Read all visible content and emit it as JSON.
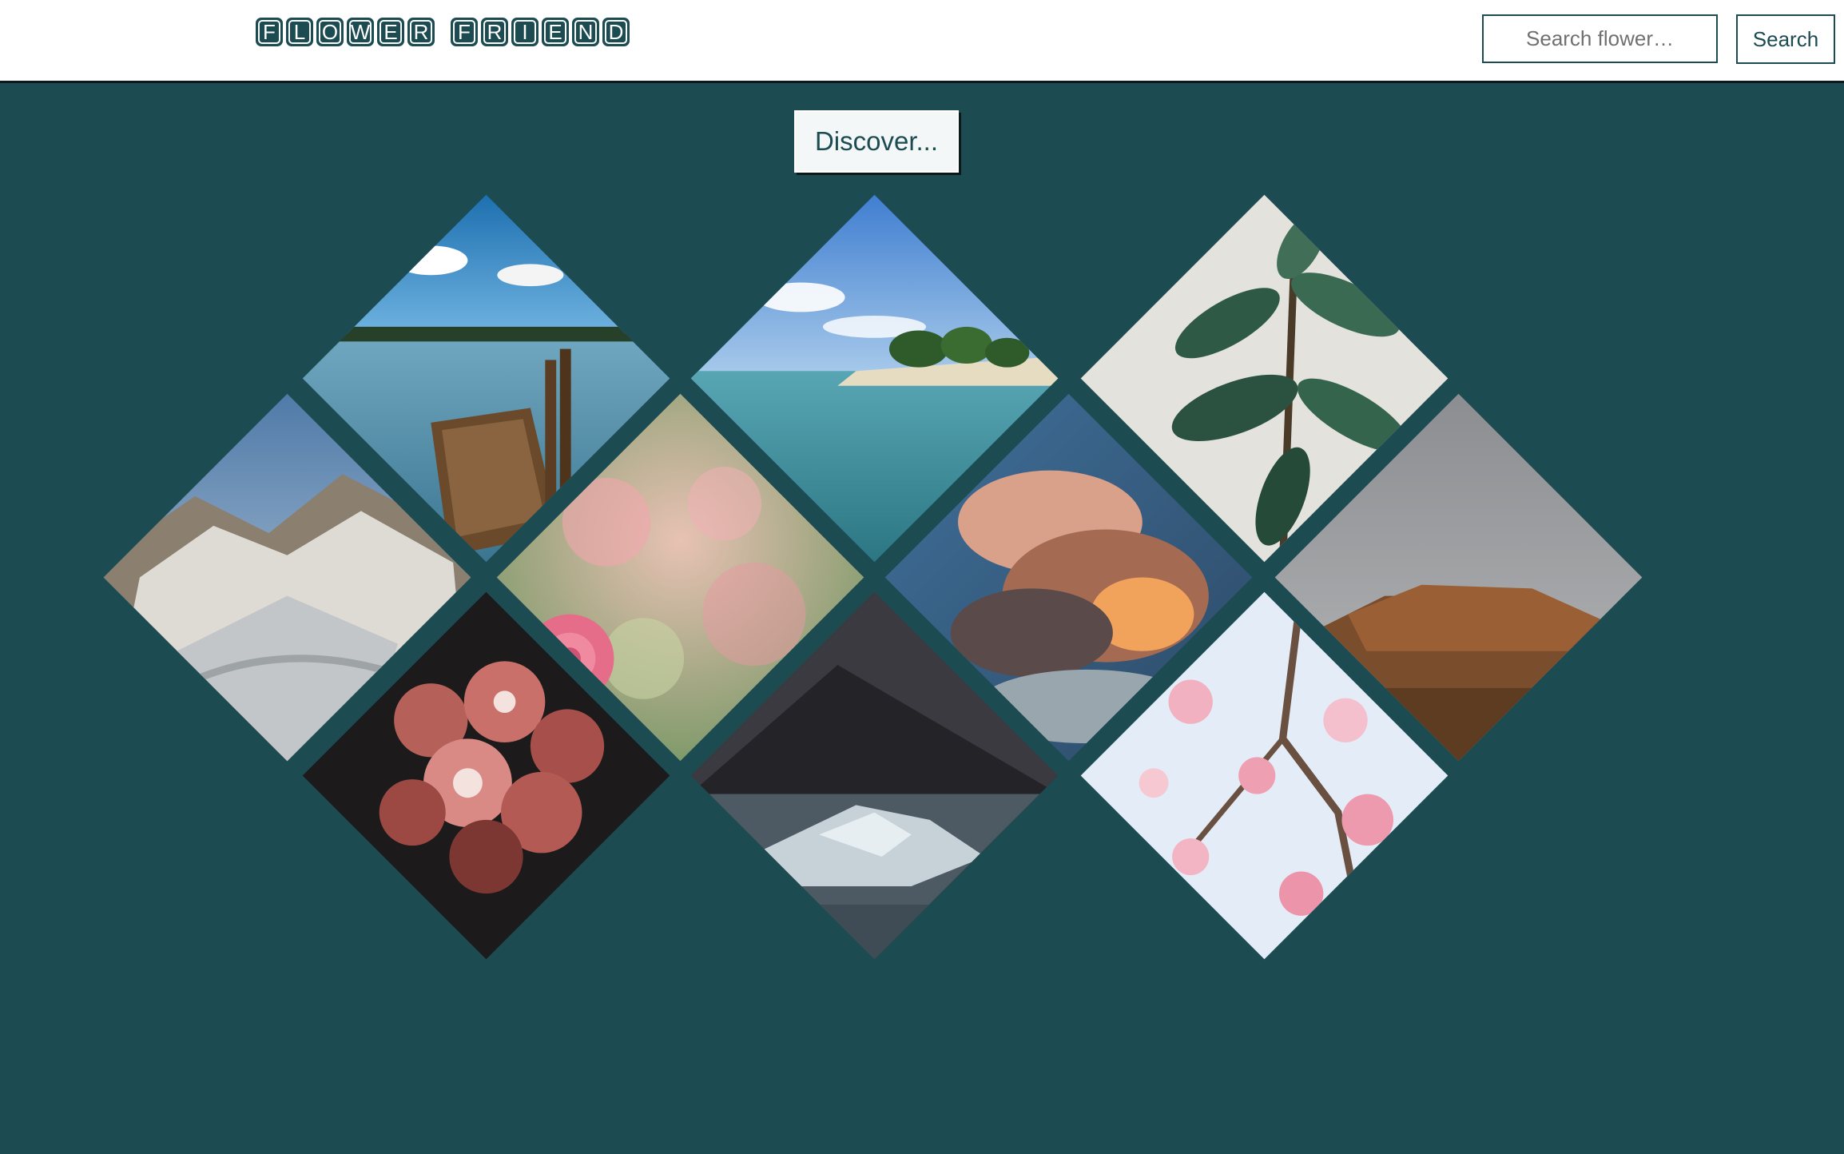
{
  "header": {
    "logo_letters_1": [
      "F",
      "L",
      "O",
      "W",
      "E",
      "R"
    ],
    "logo_letters_2": [
      "F",
      "R",
      "I",
      "E",
      "N",
      "D"
    ],
    "search_placeholder": "Search flower…",
    "search_button_label": "Search"
  },
  "main": {
    "discover_label": "Discover..."
  },
  "gallery": {
    "tiles": [
      {
        "name": "tile-lake-dock",
        "subject": "lake with wooden raft dock"
      },
      {
        "name": "tile-beach-island",
        "subject": "tropical beach island"
      },
      {
        "name": "tile-green-plant",
        "subject": "rubber plant leaves"
      },
      {
        "name": "tile-glacier",
        "subject": "snowy glacier mountains"
      },
      {
        "name": "tile-pink-rose",
        "subject": "pink rose blurred background"
      },
      {
        "name": "tile-sunset-clouds",
        "subject": "orange sunset clouds"
      },
      {
        "name": "tile-desert-hill",
        "subject": "brown rocky hill grey sky"
      },
      {
        "name": "tile-red-geranium",
        "subject": "red geranium flowers dark background"
      },
      {
        "name": "tile-iceberg-lake",
        "subject": "iceberg in mountain lake"
      },
      {
        "name": "tile-cherry-blossom",
        "subject": "pink cherry blossom branch"
      }
    ]
  },
  "colors": {
    "brand": "#1c4b51",
    "header_bg": "#ffffff",
    "header_border": "#0c1a1c"
  }
}
